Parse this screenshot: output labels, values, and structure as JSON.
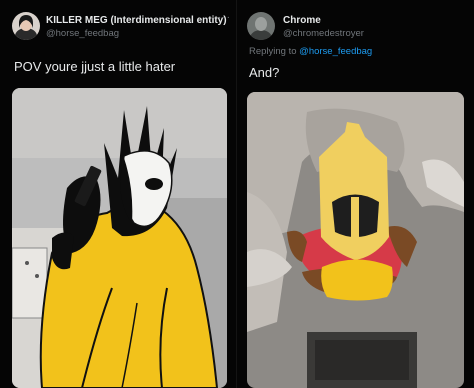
{
  "left_post": {
    "display_name": "KILLER MEG (Interdimensional entity)",
    "handle": "@horse_feedbag",
    "more_label": "···",
    "text": "POV youre jjust a little hater",
    "media_icon": "drawing-over-photo"
  },
  "right_post": {
    "display_name": "Chrome",
    "handle": "@chromedestroyer",
    "replying_prefix": "Replying to ",
    "replying_handle": "@horse_feedbag",
    "text": "And?",
    "media_icon": "drawing-over-photo"
  },
  "colors": {
    "background": "#050505",
    "text": "#e7e9ea",
    "muted": "#71767b",
    "link": "#1d9bf0",
    "drawing_yellow": "#f2c21b"
  }
}
